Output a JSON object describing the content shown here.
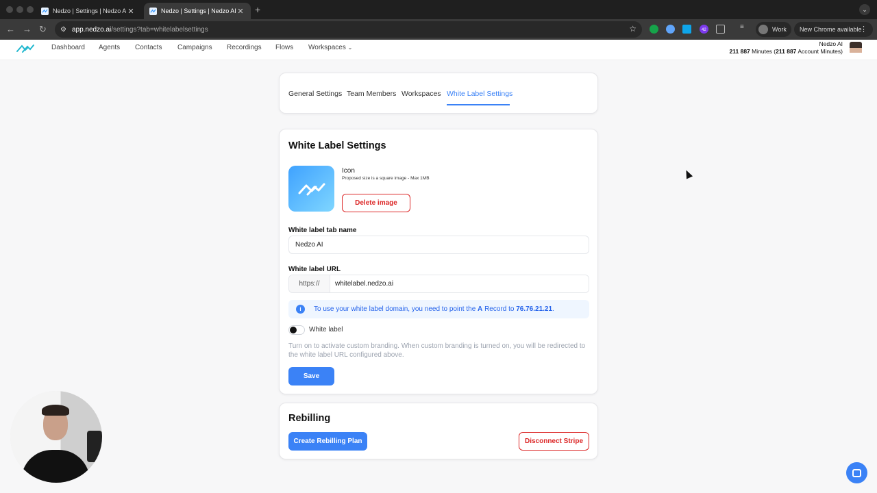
{
  "browser": {
    "tabs": [
      {
        "title": "Nedzo | Settings | Nedzo AI",
        "active": false
      },
      {
        "title": "Nedzo | Settings | Nedzo AI",
        "active": true
      }
    ],
    "url_host": "app.nedzo.ai",
    "url_path": "/settings?tab=whitelabelsettings",
    "profile_label": "Work",
    "update_label": "New Chrome available",
    "extension_badge": "42"
  },
  "nav": {
    "items": [
      "Dashboard",
      "Agents",
      "Contacts",
      "Campaigns",
      "Recordings",
      "Flows",
      "Workspaces"
    ],
    "account_name": "Nedzo AI",
    "minutes_value": "211 887",
    "minutes_label": "Minutes",
    "account_minutes_value": "211 887",
    "account_minutes_label": "Account Minutes"
  },
  "settings_tabs": {
    "items": [
      "General Settings",
      "Team Members",
      "Workspaces",
      "White Label Settings"
    ],
    "active": "White Label Settings"
  },
  "white_label": {
    "title": "White Label Settings",
    "icon_label": "Icon",
    "icon_hint": "Proposed size is a square image - Max 1MB",
    "delete_image_label": "Delete image",
    "tab_name_label": "White label tab name",
    "tab_name_value": "Nedzo AI",
    "url_label": "White label URL",
    "url_prefix": "https://",
    "url_value": "whitelabel.nedzo.ai",
    "info_prefix": "To use your white label domain, you need to point the",
    "info_record": "A",
    "info_middle": "Record to",
    "info_ip": "76.76.21.21",
    "info_suffix": ".",
    "toggle_label": "White label",
    "toggle_on": false,
    "toggle_desc": "Turn on to activate custom branding. When custom branding is turned on, you will be redirected to the white label URL configured above.",
    "save_label": "Save"
  },
  "rebilling": {
    "title": "Rebilling",
    "create_label": "Create Rebilling Plan",
    "disconnect_label": "Disconnect Stripe"
  },
  "colors": {
    "accent": "#3b82f6",
    "danger": "#dc2626"
  }
}
